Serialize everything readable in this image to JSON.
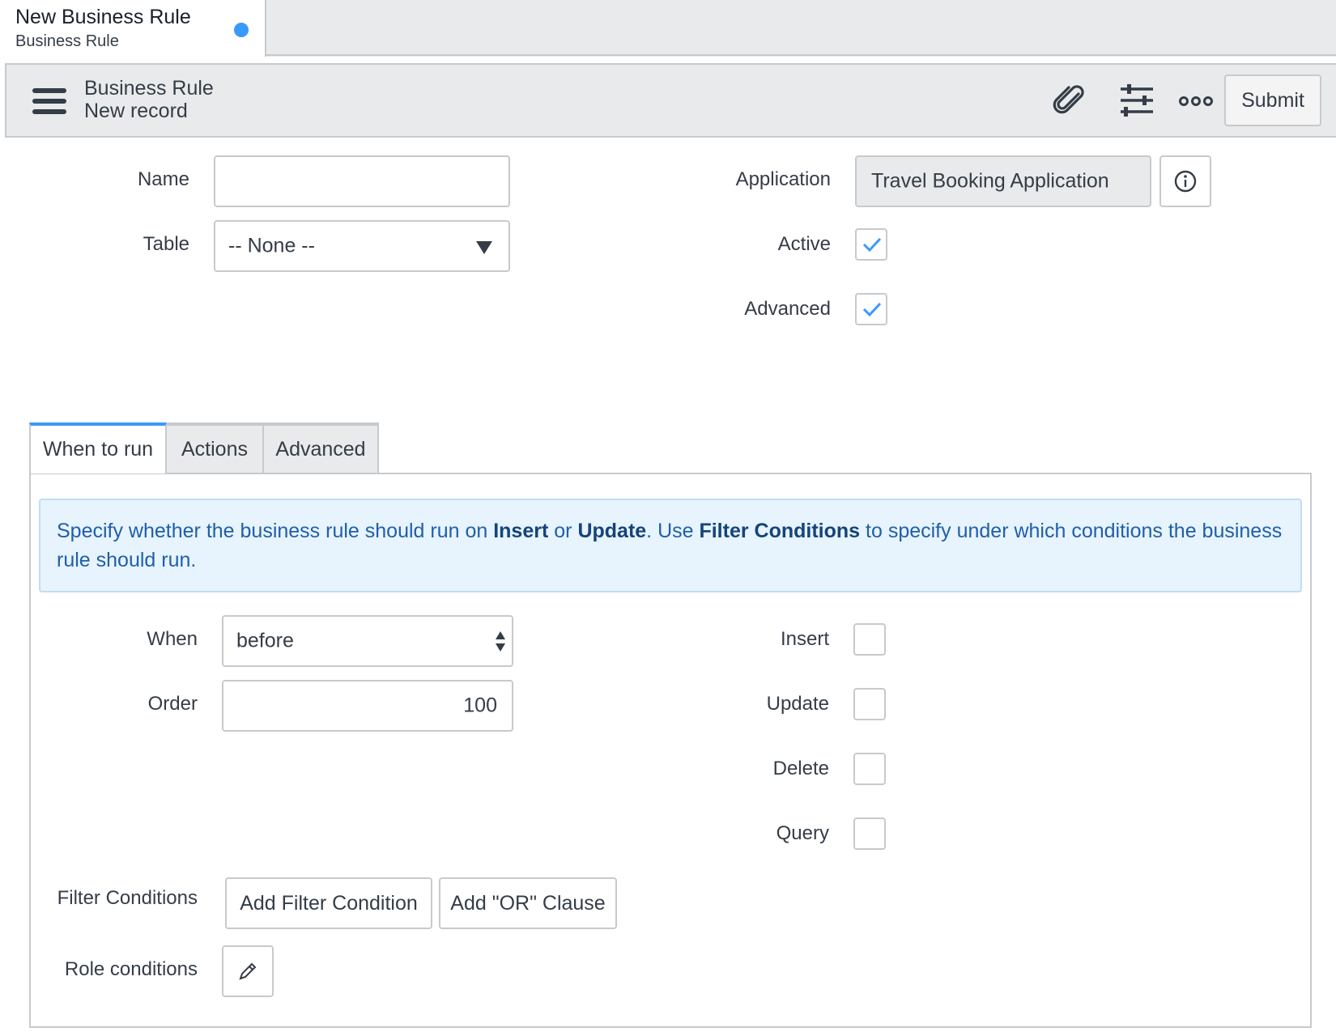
{
  "doc_tab": {
    "title": "New Business Rule",
    "subtitle": "Business Rule"
  },
  "header": {
    "title": "Business Rule",
    "subtitle": "New record",
    "submit_label": "Submit"
  },
  "form": {
    "name_label": "Name",
    "name_value": "",
    "table_label": "Table",
    "table_value": "-- None --",
    "application_label": "Application",
    "application_value": "Travel Booking Application",
    "active_label": "Active",
    "active_checked": true,
    "advanced_label": "Advanced",
    "advanced_checked": true
  },
  "tabs": [
    {
      "label": "When to run",
      "active": true
    },
    {
      "label": "Actions",
      "active": false
    },
    {
      "label": "Advanced",
      "active": false
    }
  ],
  "info": {
    "part1": "Specify whether the business rule should run on ",
    "insert": "Insert",
    "part2": " or ",
    "update": "Update",
    "part3": ". Use ",
    "filter": "Filter Conditions",
    "part4": " to specify under which conditions the business rule should run."
  },
  "when_to_run": {
    "when_label": "When",
    "when_value": "before",
    "order_label": "Order",
    "order_value": "100",
    "insert_label": "Insert",
    "update_label": "Update",
    "delete_label": "Delete",
    "query_label": "Query",
    "filter_conditions_label": "Filter Conditions",
    "add_filter_label": "Add Filter Condition",
    "add_or_label": "Add \"OR\" Clause",
    "role_conditions_label": "Role conditions"
  },
  "colors": {
    "accent": "#3b99fc",
    "info_bg": "#e7f3fd",
    "info_text": "#1f5faa"
  },
  "icons": [
    "hamburger-icon",
    "paperclip-icon",
    "sliders-icon",
    "more-icon",
    "info-icon",
    "checkmark-icon",
    "pencil-icon"
  ]
}
